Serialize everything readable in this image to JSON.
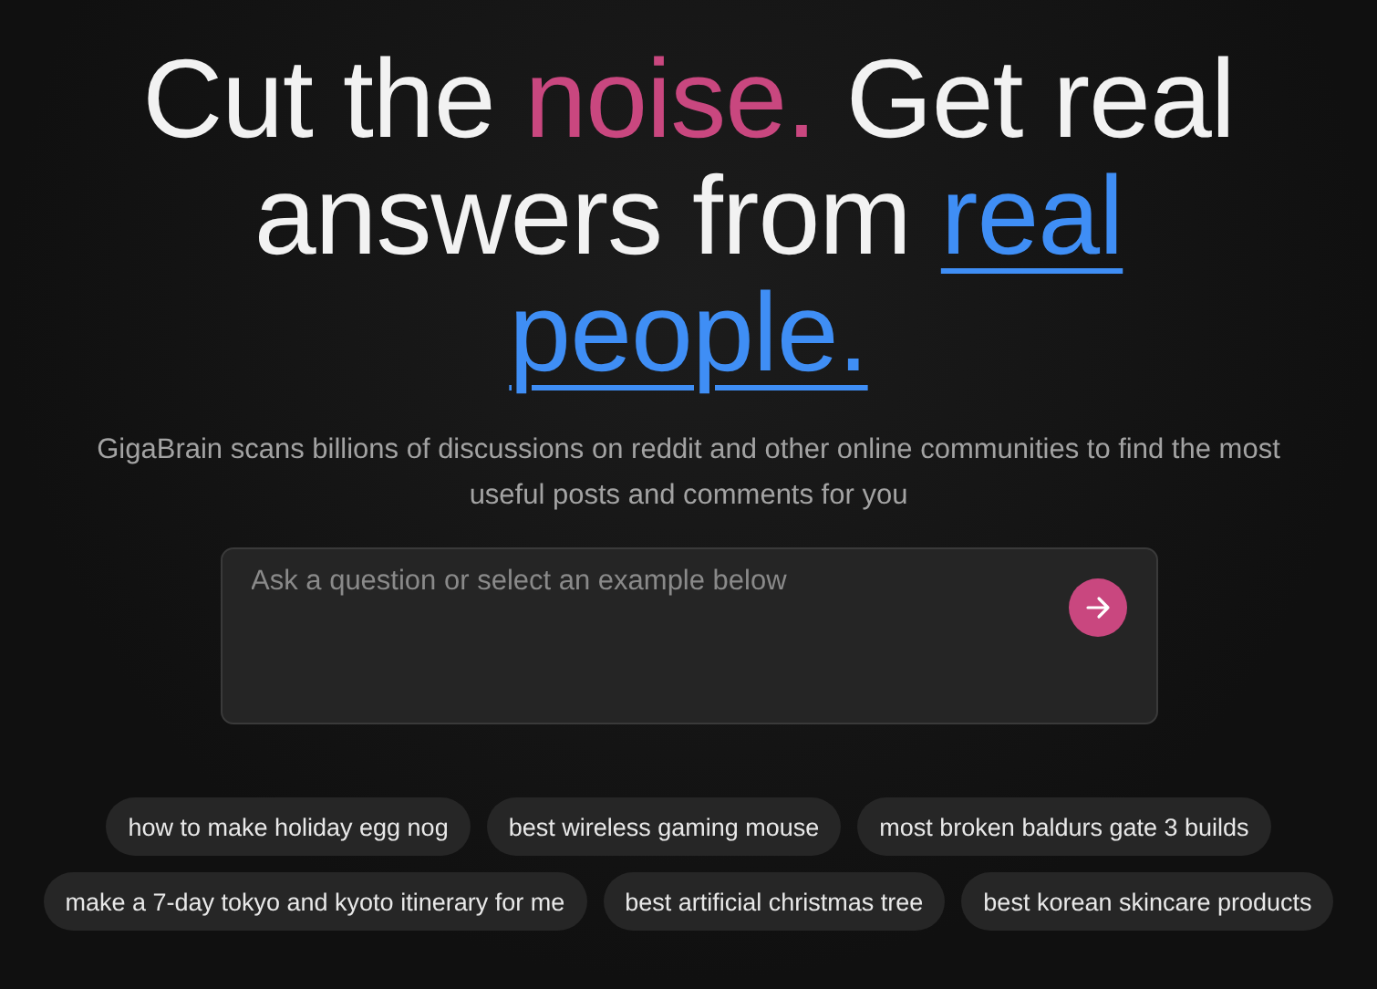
{
  "headline": [
    {
      "text": "Cut the ",
      "kind": "plain"
    },
    {
      "text": "noise.",
      "kind": "accent"
    },
    {
      "text": " Get real answers from ",
      "kind": "plain"
    },
    {
      "text": "real people.",
      "kind": "link"
    }
  ],
  "subtitle": "GigaBrain scans billions of discussions on reddit and other online communities to find the most useful posts and comments for you",
  "search": {
    "placeholder": "Ask a question or select an example below"
  },
  "examples": [
    "how to make holiday egg nog",
    "best wireless gaming mouse",
    "most broken baldurs gate 3 builds",
    "make a 7-day tokyo and kyoto itinerary for me",
    "best artificial christmas tree",
    "best korean skincare products"
  ]
}
